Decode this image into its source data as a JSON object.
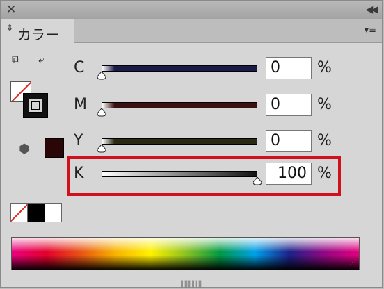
{
  "titlebar": {
    "close_icon": "✕",
    "collapse_icon": "◀◀"
  },
  "tab": {
    "updown_icon": "⇕",
    "label": "カラー",
    "menu_icon": "▾≡"
  },
  "tools": {
    "default_icon": "⧉",
    "swap_icon": "⤶"
  },
  "cube_icon": "⬢",
  "channels": [
    {
      "label": "C",
      "value": "0",
      "unit": "%",
      "ramp_end": "#1b1b4a",
      "level": 0
    },
    {
      "label": "M",
      "value": "0",
      "unit": "%",
      "ramp_end": "#3a1010",
      "level": 0
    },
    {
      "label": "Y",
      "value": "0",
      "unit": "%",
      "ramp_end": "#2a2a12",
      "level": 0
    },
    {
      "label": "K",
      "value": "100",
      "unit": "%",
      "ramp_end": "#1a1a1a",
      "level": 100
    }
  ],
  "colors": {
    "current": "#2a0606",
    "highlight": "#d0101c"
  },
  "handle_icon": "‖‖‖‖‖‖‖‖",
  "grip_icon": "⋰"
}
